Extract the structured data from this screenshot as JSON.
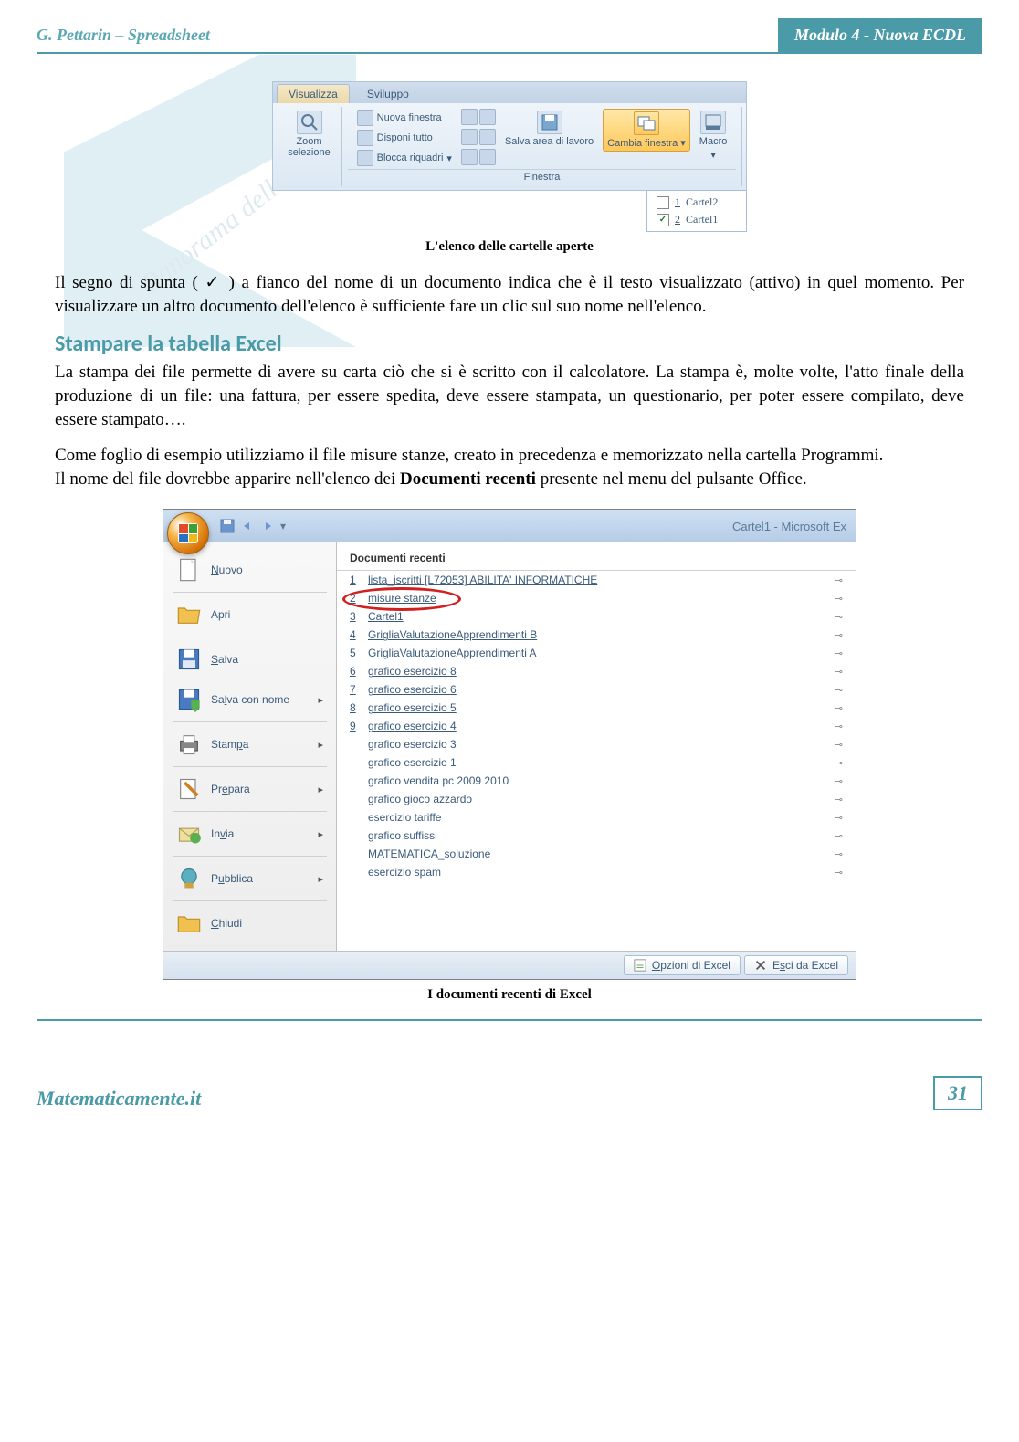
{
  "header": {
    "left": "G. Pettarin – Spreadsheet",
    "right": "Modulo 4 - Nuova ECDL"
  },
  "ribbon": {
    "tabs": {
      "view": "Visualizza",
      "dev": "Sviluppo"
    },
    "zoom_sel": "Zoom selezione",
    "new_window": "Nuova finestra",
    "arrange_all": "Disponi tutto",
    "freeze_panes": "Blocca riquadri",
    "save_workspace": "Salva area di lavoro",
    "switch_windows": "Cambia finestra",
    "macro": "Macro",
    "group_window": "Finestra",
    "dropdown": {
      "item1_num": "1",
      "item1_name": "Cartel2",
      "item2_num": "2",
      "item2_name": "Cartel1",
      "checked": "✓"
    }
  },
  "caption1": "L'elenco delle cartelle aperte",
  "para1": "Il segno di spunta ( ✓ ) a fianco del nome di un documento indica che è il testo visualizzato (attivo) in quel momento. Per visualizzare un altro documento dell'elenco è sufficiente fare un clic sul suo nome nell'elenco.",
  "section_title": "Stampare la tabella Excel",
  "para2": "La stampa dei file permette di avere su carta ciò che si è scritto con il calcolatore. La stampa è, molte volte, l'atto finale della produzione di un file: una fattura, per essere spedita, deve essere stampata, un questionario, per poter essere compilato, deve essere stampato….",
  "para3": "Come foglio di esempio utilizziamo il file misure stanze, creato in precedenza e memorizzato nella cartella Programmi.",
  "para4a": "Il nome del file dovrebbe apparire nell'elenco dei ",
  "para4b": "Documenti recenti",
  "para4c": " presente nel menu del pulsante Office.",
  "office": {
    "title": "Cartel1 - Microsoft Ex",
    "menu": {
      "nuovo": "Nuovo",
      "apri": "Apri",
      "salva": "Salva",
      "salva_nome": "Salva con nome",
      "stampa": "Stampa",
      "prepara": "Prepara",
      "invia": "Invia",
      "pubblica": "Pubblica",
      "chiudi": "Chiudi"
    },
    "recent_header": "Documenti recenti",
    "recent": [
      {
        "n": "1",
        "name": "lista_iscritti [L72053]  ABILITA' INFORMATICHE",
        "u": true
      },
      {
        "n": "2",
        "name": "misure stanze",
        "u": true,
        "circled": true
      },
      {
        "n": "3",
        "name": "Cartel1",
        "u": true
      },
      {
        "n": "4",
        "name": "GrigliaValutazioneApprendimenti B",
        "u": true
      },
      {
        "n": "5",
        "name": "GrigliaValutazioneApprendimenti A",
        "u": true
      },
      {
        "n": "6",
        "name": "grafico esercizio 8",
        "u": true
      },
      {
        "n": "7",
        "name": "grafico esercizio 6",
        "u": true
      },
      {
        "n": "8",
        "name": "grafico esercizio 5",
        "u": true
      },
      {
        "n": "9",
        "name": "grafico esercizio 4",
        "u": true
      },
      {
        "n": "",
        "name": "grafico esercizio 3",
        "u": false
      },
      {
        "n": "",
        "name": "grafico esercizio 1",
        "u": false
      },
      {
        "n": "",
        "name": "grafico vendita pc 2009 2010",
        "u": false
      },
      {
        "n": "",
        "name": "grafico gioco azzardo",
        "u": false
      },
      {
        "n": "",
        "name": "esercizio tariffe",
        "u": false
      },
      {
        "n": "",
        "name": "grafico suffissi",
        "u": false
      },
      {
        "n": "",
        "name": "MATEMATICA_soluzione",
        "u": false
      },
      {
        "n": "",
        "name": "esercizio spam",
        "u": false
      }
    ],
    "footer": {
      "options": "Opzioni di Excel",
      "exit": "Esci da Excel"
    }
  },
  "caption2": "I documenti recenti di Excel",
  "footer": {
    "brand": "Matematicamente.it",
    "page": "31"
  }
}
